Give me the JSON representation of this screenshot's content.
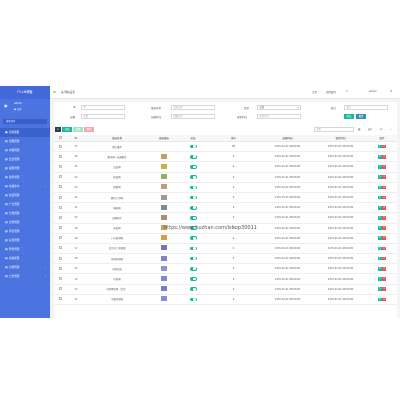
{
  "sidebar": {
    "logo": "FY-LM博客",
    "user": {
      "name": "admin",
      "status": "● 在线"
    },
    "search_placeholder": "搜索菜单",
    "items": [
      {
        "icon": "▣",
        "label": "控制面板",
        "caret": "",
        "active": true
      },
      {
        "icon": "▤",
        "label": "常规管理",
        "caret": ""
      },
      {
        "icon": "▤",
        "label": "内容管理",
        "caret": ""
      },
      {
        "icon": "▤",
        "label": "会员管理",
        "caret": ""
      },
      {
        "icon": "▤",
        "label": "权限管理",
        "caret": ""
      },
      {
        "icon": "▤",
        "label": "插件管理",
        "caret": ""
      },
      {
        "icon": "▤",
        "label": "在线命令",
        "caret": "‹"
      },
      {
        "icon": "▤",
        "label": "友链管理",
        "caret": ""
      },
      {
        "icon": "▤",
        "label": "广告管理",
        "caret": ""
      },
      {
        "icon": "▤",
        "label": "分类管理",
        "caret": ""
      },
      {
        "icon": "▤",
        "label": "文章管理",
        "caret": ""
      },
      {
        "icon": "▤",
        "label": "评论管理",
        "caret": ""
      },
      {
        "icon": "▤",
        "label": "标签管理",
        "caret": ""
      },
      {
        "icon": "▤",
        "label": "附件管理",
        "caret": ""
      },
      {
        "icon": "▤",
        "label": "系统配置",
        "caret": ""
      },
      {
        "icon": "▤",
        "label": "示例管理",
        "caret": "‹"
      },
      {
        "icon": "▤",
        "label": "日志管理",
        "caret": "‹"
      }
    ]
  },
  "topbar": {
    "tab_label": "网站设置",
    "right": [
      "主页",
      "清除缓存",
      "✕",
      "admin",
      "⚙"
    ]
  },
  "filters": {
    "id_label": "ID",
    "id_placeholder": "ID",
    "name_label": "链接名称",
    "name_placeholder": "链接名称",
    "type_label": "类型",
    "type_value": "全部",
    "remark_label": "备注",
    "remark_placeholder": "备注",
    "weigh_label": "权重",
    "weigh_placeholder": "权重",
    "create_label": "创建时间",
    "create_placeholder": "创建时间",
    "update_label": "更新时间",
    "update_placeholder": "更新时间",
    "submit_label": "提交",
    "reset_label": "重置"
  },
  "toolbar": {
    "refresh": "⟳",
    "add": "添加",
    "edit": "编辑",
    "delete": "删除",
    "search_placeholder": "搜索"
  },
  "watermark": "https://www.huzhan.com/ishop30011",
  "table": {
    "headers": [
      "",
      "ID",
      "链接名称",
      "链接图标",
      "状态",
      "排序",
      "创建时间",
      "更新时间",
      "操作"
    ],
    "rows": [
      {
        "id": "27",
        "name": "博主推荐",
        "thumb": "",
        "sort": "99",
        "ctime": "1970-01-01 08:00:00",
        "utime": "1970-01-01 08:00:00"
      },
      {
        "id": "28",
        "name": "腾讯网一站通服务",
        "thumb": "#c4a060",
        "sort": "0",
        "ctime": "1970-01-01 08:00:00",
        "utime": "1970-01-01 08:00:00"
      },
      {
        "id": "25",
        "name": "百度网",
        "thumb": "#c8b04a",
        "sort": "0",
        "ctime": "1970-01-01 08:00:00",
        "utime": "1970-01-01 08:00:00"
      },
      {
        "id": "24",
        "name": "新浪网",
        "thumb": "#8fb06a",
        "sort": "0",
        "ctime": "1970-01-01 08:00:00",
        "utime": "1970-01-01 08:00:00"
      },
      {
        "id": "23",
        "name": "搜狐网",
        "thumb": "#b8a080",
        "sort": "0",
        "ctime": "1970-01-01 08:00:00",
        "utime": "1970-01-01 08:00:00"
      },
      {
        "id": "22",
        "name": "腾讯大学网",
        "thumb": "#9a9a9a",
        "sort": "0",
        "ctime": "1970-01-01 08:00:00",
        "utime": "1970-01-01 08:00:00"
      },
      {
        "id": "21",
        "name": "网易网",
        "thumb": "#7a8c9a",
        "sort": "0",
        "ctime": "1970-01-01 08:00:00",
        "utime": "1970-01-01 08:00:00"
      },
      {
        "id": "20",
        "name": "凤凰网子",
        "thumb": "#a89070",
        "sort": "0",
        "ctime": "1970-01-01 08:00:00",
        "utime": "1970-01-01 08:00:00"
      },
      {
        "id": "19",
        "name": "天涯网",
        "thumb": "#c8a050",
        "sort": "0",
        "ctime": "1970-01-01 08:00:00",
        "utime": "1970-01-01 08:00:00"
      },
      {
        "id": "18",
        "name": "广州新闻网",
        "thumb": "#d0a040",
        "sort": "0",
        "ctime": "1970-01-01 08:00:00",
        "utime": "1970-01-01 08:00:00"
      },
      {
        "id": "17",
        "name": "北京中工商管理",
        "thumb": "#7070c8",
        "sort": "0",
        "ctime": "1970-01-01 08:00:00",
        "utime": "1970-01-01 08:00:00"
      },
      {
        "id": "16",
        "name": "环球新闻网",
        "thumb": "#8080d0",
        "sort": "0",
        "ctime": "1970-01-01 08:00:00",
        "utime": "1970-01-01 08:00:00"
      },
      {
        "id": "15",
        "name": "中国日报",
        "thumb": "#9090d8",
        "sort": "0",
        "ctime": "1970-01-01 08:00:00",
        "utime": "1970-01-01 08:00:00"
      },
      {
        "id": "14",
        "name": "中新网",
        "thumb": "#8585d0",
        "sort": "0",
        "ctime": "1970-01-01 08:00:00",
        "utime": "1970-01-01 08:00:00"
      },
      {
        "id": "13",
        "name": "中新经纬网（北京）",
        "thumb": "#7b7bc8",
        "sort": "0",
        "ctime": "1970-01-01 08:00:00",
        "utime": "1970-01-01 08:00:00"
      },
      {
        "id": "12",
        "name": "中通快递网",
        "thumb": "#8a8ad0",
        "sort": "0",
        "ctime": "1970-01-01 08:00:00",
        "utime": "1970-01-01 08:00:00"
      }
    ]
  },
  "colors": {
    "sidebar": "#4b74e0",
    "accent": "#18bc9c",
    "danger": "#f05050",
    "primary": "#3c8dbc"
  }
}
